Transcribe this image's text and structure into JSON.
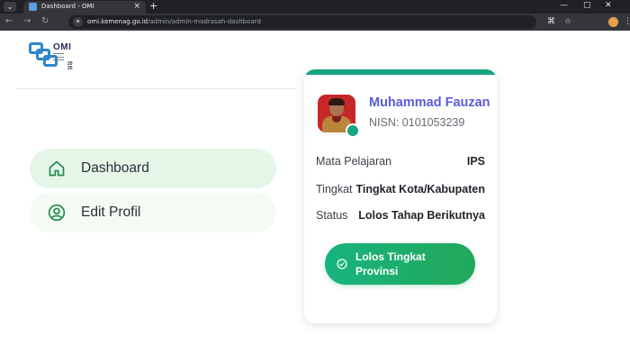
{
  "browser": {
    "tab_title": "Dashboard - OMI",
    "tab_close": "×",
    "new_tab": "+",
    "url_host": "omi.kemenag.go.id",
    "url_path": "/admin/admin-madrasah-dashboard",
    "window_controls": [
      "—",
      "▢",
      "✕"
    ]
  },
  "logo": {
    "title": "OMI",
    "year": "20\n25"
  },
  "sidebar": {
    "items": [
      {
        "label": "Dashboard",
        "icon": "home-icon",
        "active": true
      },
      {
        "label": "Edit Profil",
        "icon": "user-circle-icon",
        "active": false
      }
    ]
  },
  "card": {
    "student_name": "Muhammad Fauzan",
    "nisn": "NISN: 0101053239",
    "rows": [
      {
        "label": "Mata Pelajaran",
        "value": "IPS"
      },
      {
        "label": "Tingkat",
        "value": "Tingkat Kota/Kabupaten"
      },
      {
        "label": "Status",
        "value": "Lolos Tahap Berikutnya"
      }
    ],
    "cta_label": "Lolos Tingkat Provinsi",
    "accent_color": "#17a47f",
    "name_color": "#5c5bd8"
  }
}
